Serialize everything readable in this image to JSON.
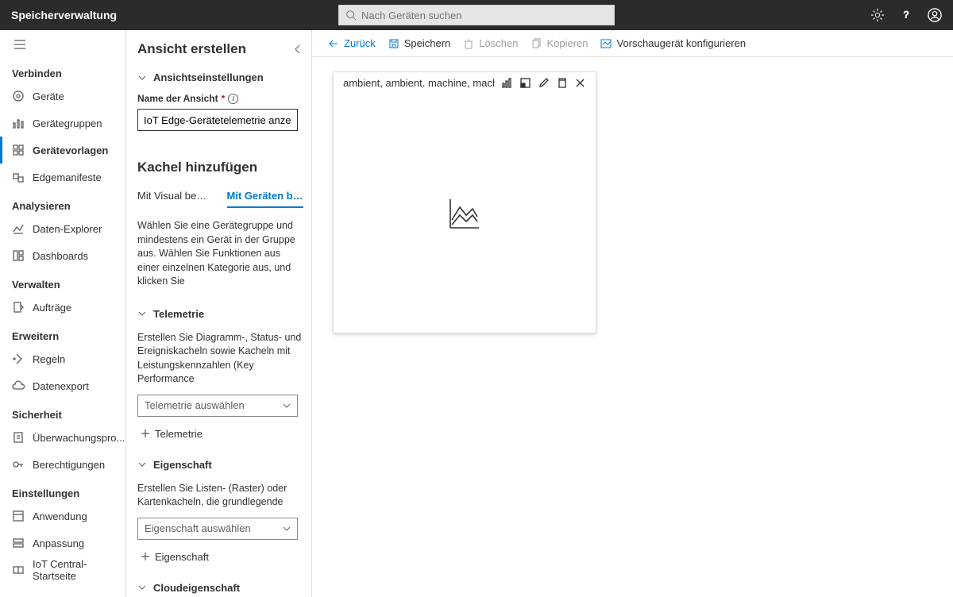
{
  "app_title": "Speicherverwaltung",
  "search_placeholder": "Nach Geräten suchen",
  "nav": {
    "groups": [
      {
        "title": "Verbinden",
        "items": [
          {
            "id": "devices",
            "label": "Geräte"
          },
          {
            "id": "devicegroups",
            "label": "Gerätegruppen"
          },
          {
            "id": "templates",
            "label": "Gerätevorlagen",
            "active": true
          },
          {
            "id": "edgemanifests",
            "label": "Edgemanifeste"
          }
        ]
      },
      {
        "title": "Analysieren",
        "items": [
          {
            "id": "explorer",
            "label": "Daten-Explorer"
          },
          {
            "id": "dashboards",
            "label": "Dashboards"
          }
        ]
      },
      {
        "title": "Verwalten",
        "items": [
          {
            "id": "jobs",
            "label": "Aufträge"
          }
        ]
      },
      {
        "title": "Erweitern",
        "items": [
          {
            "id": "rules",
            "label": "Regeln"
          },
          {
            "id": "dataexport",
            "label": "Datenexport"
          }
        ]
      },
      {
        "title": "Sicherheit",
        "items": [
          {
            "id": "audit",
            "label": "Überwachungspro..."
          },
          {
            "id": "perms",
            "label": "Berechtigungen"
          }
        ]
      },
      {
        "title": "Einstellungen",
        "items": [
          {
            "id": "application",
            "label": "Anwendung"
          },
          {
            "id": "customize",
            "label": "Anpassung"
          },
          {
            "id": "iotcentral",
            "label": "IoT Central-Startseite"
          }
        ]
      }
    ]
  },
  "cmdbar": {
    "back": "Zurück",
    "save": "Speichern",
    "delete": "Löschen",
    "copy": "Kopieren",
    "preview": "Vorschaugerät konfigurieren"
  },
  "editor": {
    "heading": "Ansicht erstellen",
    "view_settings": "Ansichtseinstellungen",
    "view_name_label": "Name der Ansicht",
    "view_name_value": "IoT Edge-Gerätetelemetrie anzeigen",
    "add_tile": "Kachel hinzufügen",
    "tabs": {
      "visual": "Mit Visual begin...",
      "devices": "Mit Geräten beg..."
    },
    "devices_help": "Wählen Sie eine Gerätegruppe und mindestens ein Gerät in der Gruppe aus. Wählen Sie Funktionen aus einer einzelnen Kategorie aus, und klicken Sie",
    "telemetry": {
      "title": "Telemetrie",
      "help": "Erstellen Sie Diagramm-, Status- und Ereigniskacheln sowie Kacheln mit Leistungskennzahlen (Key Performance",
      "dropdown": "Telemetrie auswählen",
      "add": "Telemetrie"
    },
    "property": {
      "title": "Eigenschaft",
      "help": "Erstellen Sie Listen- (Raster) oder Kartenkacheln, die grundlegende",
      "dropdown": "Eigenschaft auswählen",
      "add": "Eigenschaft"
    },
    "cloudproperty": {
      "title": "Cloudeigenschaft"
    }
  },
  "tile": {
    "title": "ambient, ambient. machine, machi"
  }
}
